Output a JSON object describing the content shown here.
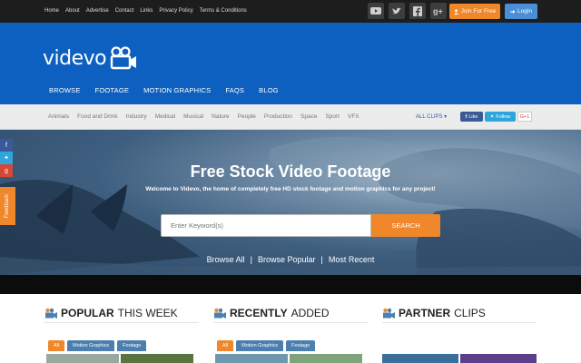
{
  "topbar": {
    "links": [
      "Home",
      "About",
      "Advertise",
      "Contact",
      "Links",
      "Privacy Policy",
      "Terms & Conditions"
    ],
    "social_icons": [
      "youtube-icon",
      "twitter-icon",
      "facebook-icon",
      "google-plus-icon"
    ],
    "join_label": "Join For Free",
    "login_label": "Login"
  },
  "header": {
    "logo_text": "videvo",
    "nav": [
      "BROWSE",
      "FOOTAGE",
      "MOTION GRAPHICS",
      "FAQS",
      "BLOG"
    ]
  },
  "categories": {
    "items": [
      "Animals",
      "Food and Drink",
      "Industry",
      "Medical",
      "Musical",
      "Nature",
      "People",
      "Production",
      "Space",
      "Sport",
      "VFX"
    ],
    "all_clips_label": "ALL CLIPS",
    "fb_like": "Like",
    "tw_follow": "Follow",
    "gplus": "G+1"
  },
  "hero": {
    "title": "Free Stock Video Footage",
    "subtitle": "Welcome to Videvo, the home of completely free HD stock footage and motion graphics for any project!",
    "search_placeholder": "Enter Keyword(s)",
    "search_button": "SEARCH",
    "links": [
      "Browse All",
      "Browse Popular",
      "Most Recent"
    ],
    "feedback_label": "Feedback"
  },
  "columns": [
    {
      "bold": "POPULAR",
      "normal": "THIS WEEK",
      "tabs": [
        "All",
        "Motion Graphics",
        "Footage"
      ]
    },
    {
      "bold": "RECENTLY",
      "normal": "ADDED",
      "tabs": [
        "All",
        "Motion Graphics",
        "Footage"
      ]
    },
    {
      "bold": "PARTNER",
      "normal": "CLIPS",
      "tabs": []
    }
  ],
  "colors": {
    "brand_blue": "#0d60c0",
    "accent_orange": "#f0872b",
    "topbar_bg": "#1d1d1d"
  }
}
